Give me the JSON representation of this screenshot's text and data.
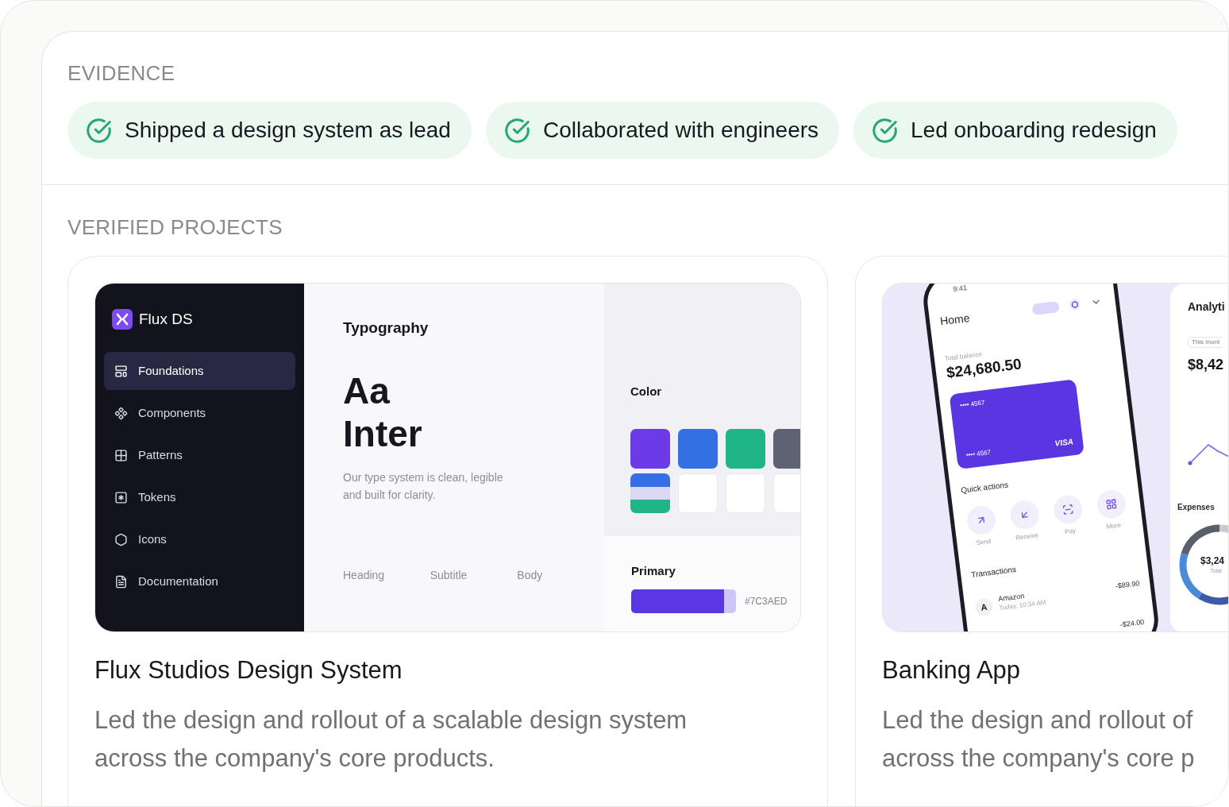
{
  "evidence": {
    "heading": "EVIDENCE",
    "items": [
      {
        "label": "Shipped a design system as lead"
      },
      {
        "label": "Collaborated with engineers"
      },
      {
        "label": "Led onboarding redesign"
      }
    ]
  },
  "projects": {
    "heading": "VERIFIED PROJECTS",
    "cards": [
      {
        "kind": "design_system",
        "title": "Flux Studios Design System",
        "description_lines": [
          "Led the design and rollout of a scalable design system",
          "across the company's core products."
        ],
        "preview": {
          "brand": "Flux DS",
          "nav": [
            {
              "label": "Foundations",
              "selected": true
            },
            {
              "label": "Components",
              "selected": false
            },
            {
              "label": "Patterns",
              "selected": false
            },
            {
              "label": "Tokens",
              "selected": false
            },
            {
              "label": "Icons",
              "selected": false
            },
            {
              "label": "Documentation",
              "selected": false
            }
          ],
          "section_title": "Typography",
          "specimen_lines": [
            "Aa",
            "Inter"
          ],
          "note_lines": [
            "Our type system is clean, legible",
            "and built for clarity."
          ],
          "styles": [
            "Heading",
            "Subtitle",
            "Body"
          ],
          "color_title": "Color",
          "swatches": [
            {
              "kind": "solid",
              "color": "#6a3be6"
            },
            {
              "kind": "solid",
              "color": "#3270e4"
            },
            {
              "kind": "solid",
              "color": "#1fb586"
            },
            {
              "kind": "solid",
              "color": "#5e6273"
            },
            {
              "kind": "striped"
            },
            {
              "kind": "empty"
            },
            {
              "kind": "empty"
            },
            {
              "kind": "empty"
            }
          ],
          "primary_label": "Primary",
          "primary_hex": "#7C3AED"
        }
      },
      {
        "kind": "banking",
        "title": "Banking App",
        "description_lines": [
          "Led the design and rollout of",
          "across the company's core p"
        ],
        "preview": {
          "status_time": "9:41",
          "title": "Home",
          "balance_label": "Total balance",
          "balance": "$24,680.50",
          "card": {
            "number_top": "•••• 4567",
            "number_bottom": "•••• 4567",
            "network": "VISA"
          },
          "quick_actions_title": "Quick actions",
          "quick_actions": [
            {
              "label": "Send"
            },
            {
              "label": "Receive"
            },
            {
              "label": "Pay"
            },
            {
              "label": "More"
            }
          ],
          "transactions_title": "Transactions",
          "transactions": [
            {
              "avatar": "A",
              "merchant": "Amazon",
              "time": "Today, 10:34 AM",
              "amount": "-$89.90"
            },
            {
              "amount": "-$24.00"
            }
          ],
          "analytics": {
            "title": "Analyti",
            "period": "This mont",
            "value": "$8,42",
            "expenses_title": "Expenses",
            "donut_value": "$3,24",
            "donut_label": "Total"
          }
        }
      }
    ]
  }
}
